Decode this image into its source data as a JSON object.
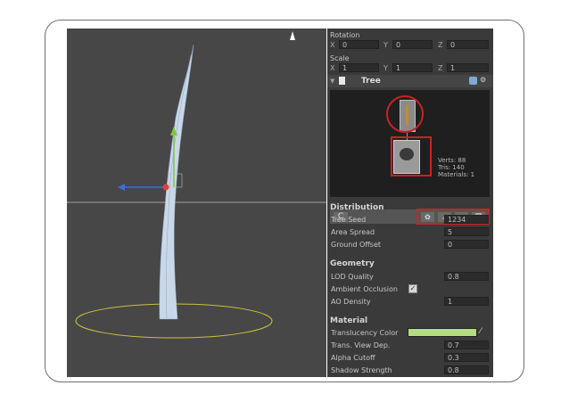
{
  "transform": {
    "rotation": {
      "label": "Rotation",
      "x": "0",
      "y": "0",
      "z": "0"
    },
    "scale": {
      "label": "Scale",
      "x": "1",
      "y": "1",
      "z": "1"
    },
    "axis_x": "X",
    "axis_y": "Y",
    "axis_z": "Z"
  },
  "tree_component": {
    "title": "Tree",
    "stats": {
      "verts": "Verts: 88",
      "tris": "Tris: 140",
      "materials": "Materials: 1"
    },
    "refresh_icon": "refresh-icon",
    "toolbar_icons": [
      "add-leaf-group-icon",
      "add-branch-group-icon",
      "duplicate-group-icon",
      "delete-group-icon"
    ]
  },
  "distribution": {
    "header": "Distribution",
    "tree_seed": {
      "label": "Tree Seed",
      "value": "1234"
    },
    "area_spread": {
      "label": "Area Spread",
      "value": "5"
    },
    "ground_offset": {
      "label": "Ground Offset",
      "value": "0"
    }
  },
  "geometry": {
    "header": "Geometry",
    "lod_quality": {
      "label": "LOD Quality",
      "value": "0.8"
    },
    "ambient_occlusion": {
      "label": "Ambient Occlusion",
      "checked": true
    },
    "ao_density": {
      "label": "AO Density",
      "value": "1"
    }
  },
  "material": {
    "header": "Material",
    "translucency_color": {
      "label": "Translucency Color",
      "color": "#b4dc82"
    },
    "trans_view_dep": {
      "label": "Trans. View Dep.",
      "value": "0.7"
    },
    "alpha_cutoff": {
      "label": "Alpha Cutoff",
      "value": "0.3"
    },
    "shadow_strength": {
      "label": "Shadow Strength",
      "value": "0.8"
    }
  },
  "colors": {
    "highlight_red": "#cc2222",
    "gizmo_green": "#7ec83c",
    "gizmo_blue": "#3b6fd6",
    "ground_ring": "#c8c23a"
  }
}
